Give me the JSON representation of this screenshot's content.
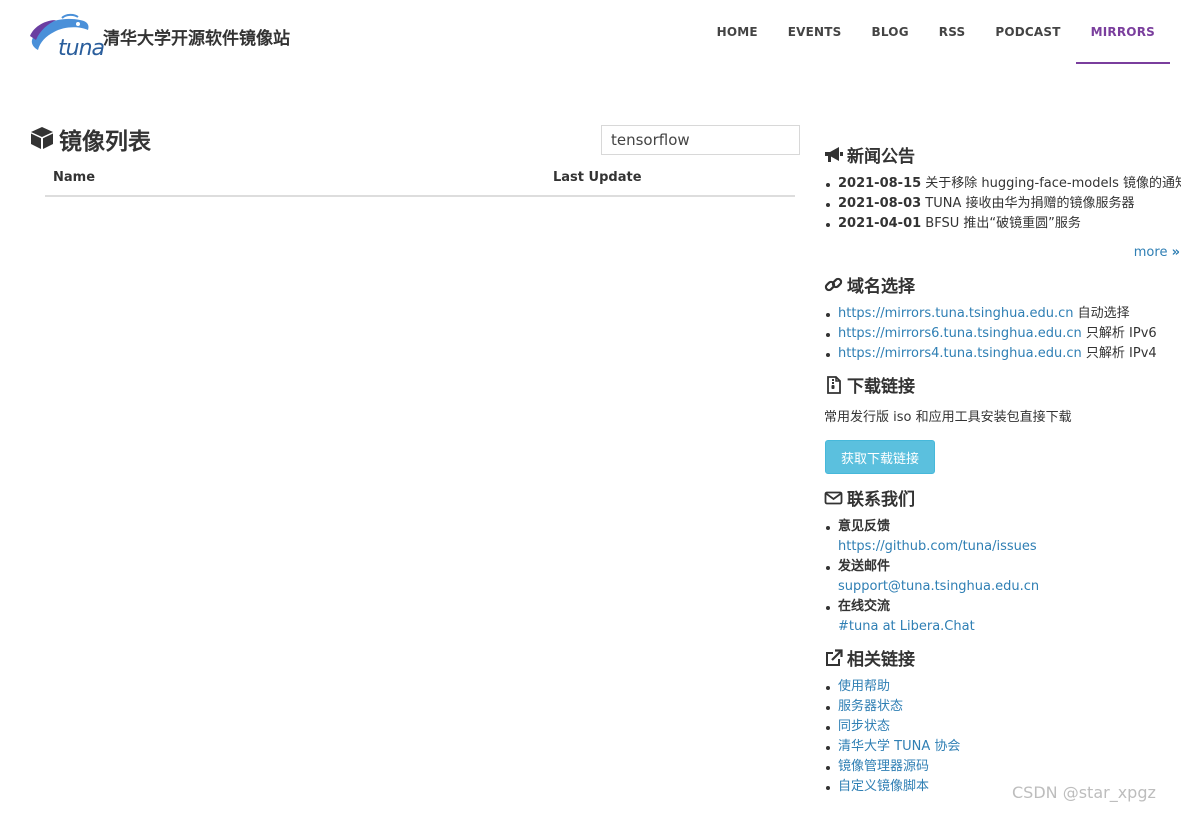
{
  "header": {
    "logo_text": "tuna",
    "site_title": "清华大学开源软件镜像站",
    "nav": [
      {
        "label": "HOME"
      },
      {
        "label": "EVENTS"
      },
      {
        "label": "BLOG"
      },
      {
        "label": "RSS"
      },
      {
        "label": "PODCAST"
      },
      {
        "label": "MIRRORS",
        "active": true
      }
    ],
    "accent_color": "#7a3e9d"
  },
  "main": {
    "title": "镜像列表",
    "filter": {
      "value": "tensorflow"
    },
    "columns": [
      "Name",
      "Last Update"
    ]
  },
  "sidebar": {
    "news": {
      "title": "新闻公告",
      "items": [
        {
          "date": "2021-08-15",
          "text": "关于移除 hugging-face-models 镜像的通知"
        },
        {
          "date": "2021-08-03",
          "text": "TUNA 接收由华为捐赠的镜像服务器"
        },
        {
          "date": "2021-04-01",
          "text": "BFSU 推出“破镜重圆”服务"
        }
      ],
      "more": "more"
    },
    "domains": {
      "title": "域名选择",
      "items": [
        {
          "url": "https://mirrors.tuna.tsinghua.edu.cn",
          "note": "自动选择"
        },
        {
          "url": "https://mirrors6.tuna.tsinghua.edu.cn",
          "note": "只解析 IPv6"
        },
        {
          "url": "https://mirrors4.tuna.tsinghua.edu.cn",
          "note": "只解析 IPv4"
        }
      ]
    },
    "download": {
      "title": "下载链接",
      "description": "常用发行版 iso 和应用工具安装包直接下载",
      "button": "获取下载链接",
      "button_color": "#5bc0de"
    },
    "contact": {
      "title": "联系我们",
      "items": [
        {
          "label": "意见反馈",
          "link": "https://github.com/tuna/issues"
        },
        {
          "label": "发送邮件",
          "link": "support@tuna.tsinghua.edu.cn"
        },
        {
          "label": "在线交流",
          "link": "#tuna at Libera.Chat"
        }
      ]
    },
    "links": {
      "title": "相关链接",
      "items": [
        "使用帮助",
        "服务器状态",
        "同步状态",
        "清华大学 TUNA 协会",
        "镜像管理器源码",
        "自定义镜像脚本"
      ]
    },
    "link_color": "#2f7fb4"
  },
  "watermark": "CSDN @star_xpgz"
}
